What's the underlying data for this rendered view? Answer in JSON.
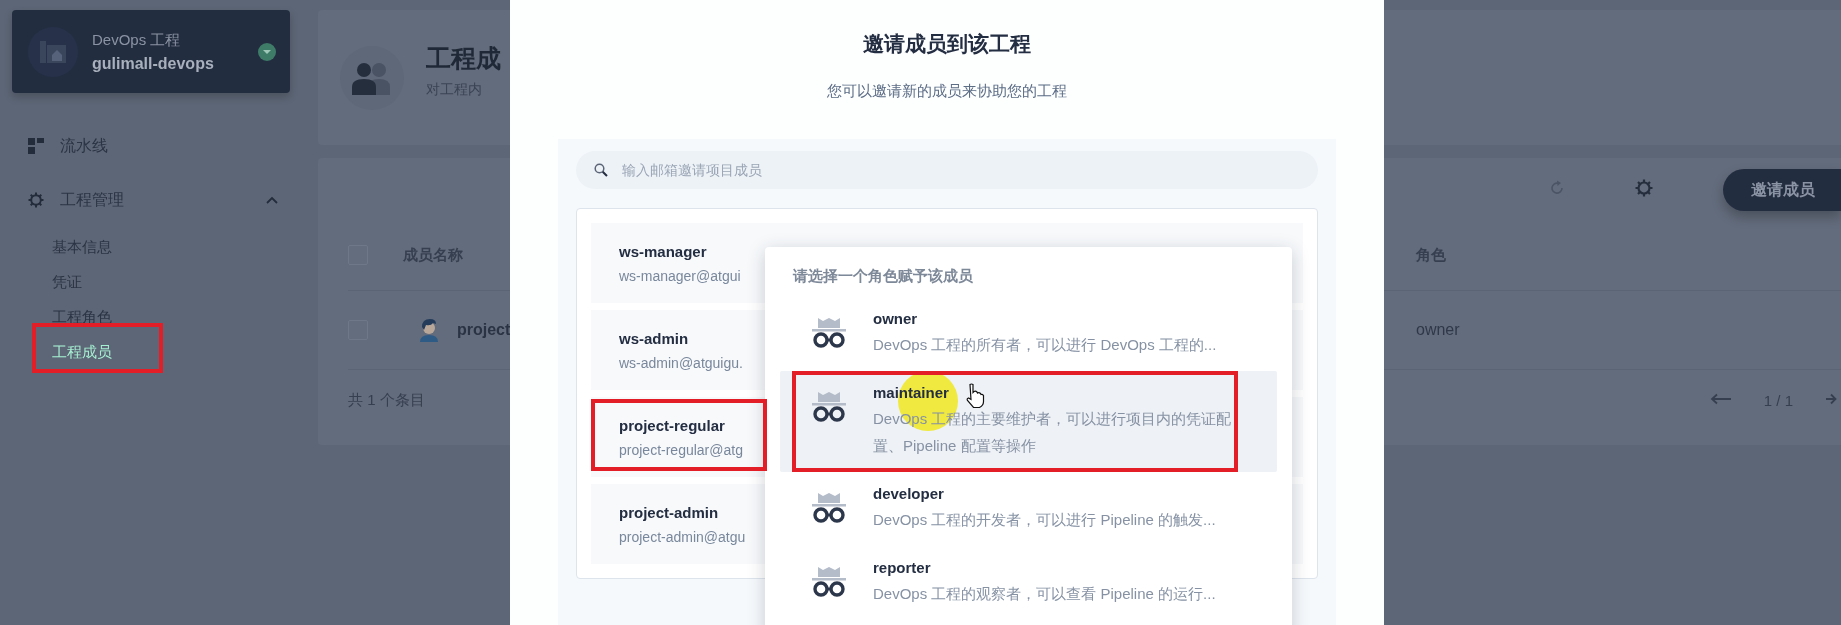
{
  "sidebar": {
    "project": {
      "type": "DevOps 工程",
      "name": "gulimall-devops"
    },
    "items": [
      {
        "kind": "link",
        "label": "流水线",
        "selected": false
      },
      {
        "kind": "group",
        "label": "工程管理",
        "selected": false,
        "expanded": true,
        "children": [
          {
            "label": "基本信息",
            "selected": false,
            "annotated": false
          },
          {
            "label": "凭证",
            "selected": false,
            "annotated": false
          },
          {
            "label": "工程角色",
            "selected": false,
            "annotated": false
          },
          {
            "label": "工程成员",
            "selected": true,
            "annotated": true
          }
        ]
      }
    ]
  },
  "page_header": {
    "title": "工程成",
    "description": "对工程内"
  },
  "toolbar": {
    "invite_button": "邀请成员"
  },
  "table": {
    "header_checked": false,
    "columns": [
      "成员名称",
      "角色"
    ],
    "rows": [
      {
        "name": "project",
        "role": "owner",
        "checked": false
      }
    ],
    "total": "共 1 个条目",
    "page": "1 / 1"
  },
  "modal": {
    "title": "邀请成员到该工程",
    "subtitle": "您可以邀请新的成员来协助您的工程",
    "search": {
      "placeholder": "输入邮箱邀请项目成员"
    },
    "members": [
      {
        "name": "ws-manager",
        "email": "ws-manager@atgui",
        "annotated": false
      },
      {
        "name": "ws-admin",
        "email": "ws-admin@atguigu.",
        "annotated": false
      },
      {
        "name": "project-regular",
        "email": "project-regular@atg",
        "annotated": true
      },
      {
        "name": "project-admin",
        "email": "project-admin@atgu",
        "annotated": false
      }
    ],
    "role_menu": {
      "title": "请选择一个角色赋予该成员",
      "roles": [
        {
          "name": "owner",
          "description": "DevOps 工程的所有者，可以进行 DevOps 工程的...",
          "selected": false,
          "annotated": false
        },
        {
          "name": "maintainer",
          "description": "DevOps 工程的主要维护者，可以进行项目内的凭证配置、Pipeline 配置等操作",
          "selected": true,
          "annotated": true
        },
        {
          "name": "developer",
          "description": "DevOps 工程的开发者，可以进行 Pipeline 的触发...",
          "selected": false,
          "annotated": false
        },
        {
          "name": "reporter",
          "description": "DevOps 工程的观察者，可以查看 Pipeline 的运行...",
          "selected": false,
          "annotated": false
        }
      ]
    }
  }
}
